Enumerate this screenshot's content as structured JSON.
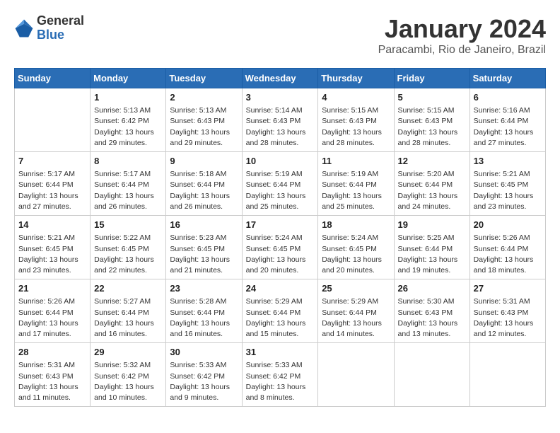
{
  "header": {
    "logo_general": "General",
    "logo_blue": "Blue",
    "title": "January 2024",
    "subtitle": "Paracambi, Rio de Janeiro, Brazil"
  },
  "calendar": {
    "days_of_week": [
      "Sunday",
      "Monday",
      "Tuesday",
      "Wednesday",
      "Thursday",
      "Friday",
      "Saturday"
    ],
    "weeks": [
      [
        {
          "day": "",
          "info": ""
        },
        {
          "day": "1",
          "info": "Sunrise: 5:13 AM\nSunset: 6:42 PM\nDaylight: 13 hours\nand 29 minutes."
        },
        {
          "day": "2",
          "info": "Sunrise: 5:13 AM\nSunset: 6:43 PM\nDaylight: 13 hours\nand 29 minutes."
        },
        {
          "day": "3",
          "info": "Sunrise: 5:14 AM\nSunset: 6:43 PM\nDaylight: 13 hours\nand 28 minutes."
        },
        {
          "day": "4",
          "info": "Sunrise: 5:15 AM\nSunset: 6:43 PM\nDaylight: 13 hours\nand 28 minutes."
        },
        {
          "day": "5",
          "info": "Sunrise: 5:15 AM\nSunset: 6:43 PM\nDaylight: 13 hours\nand 28 minutes."
        },
        {
          "day": "6",
          "info": "Sunrise: 5:16 AM\nSunset: 6:44 PM\nDaylight: 13 hours\nand 27 minutes."
        }
      ],
      [
        {
          "day": "7",
          "info": "Sunrise: 5:17 AM\nSunset: 6:44 PM\nDaylight: 13 hours\nand 27 minutes."
        },
        {
          "day": "8",
          "info": "Sunrise: 5:17 AM\nSunset: 6:44 PM\nDaylight: 13 hours\nand 26 minutes."
        },
        {
          "day": "9",
          "info": "Sunrise: 5:18 AM\nSunset: 6:44 PM\nDaylight: 13 hours\nand 26 minutes."
        },
        {
          "day": "10",
          "info": "Sunrise: 5:19 AM\nSunset: 6:44 PM\nDaylight: 13 hours\nand 25 minutes."
        },
        {
          "day": "11",
          "info": "Sunrise: 5:19 AM\nSunset: 6:44 PM\nDaylight: 13 hours\nand 25 minutes."
        },
        {
          "day": "12",
          "info": "Sunrise: 5:20 AM\nSunset: 6:44 PM\nDaylight: 13 hours\nand 24 minutes."
        },
        {
          "day": "13",
          "info": "Sunrise: 5:21 AM\nSunset: 6:45 PM\nDaylight: 13 hours\nand 23 minutes."
        }
      ],
      [
        {
          "day": "14",
          "info": "Sunrise: 5:21 AM\nSunset: 6:45 PM\nDaylight: 13 hours\nand 23 minutes."
        },
        {
          "day": "15",
          "info": "Sunrise: 5:22 AM\nSunset: 6:45 PM\nDaylight: 13 hours\nand 22 minutes."
        },
        {
          "day": "16",
          "info": "Sunrise: 5:23 AM\nSunset: 6:45 PM\nDaylight: 13 hours\nand 21 minutes."
        },
        {
          "day": "17",
          "info": "Sunrise: 5:24 AM\nSunset: 6:45 PM\nDaylight: 13 hours\nand 20 minutes."
        },
        {
          "day": "18",
          "info": "Sunrise: 5:24 AM\nSunset: 6:45 PM\nDaylight: 13 hours\nand 20 minutes."
        },
        {
          "day": "19",
          "info": "Sunrise: 5:25 AM\nSunset: 6:44 PM\nDaylight: 13 hours\nand 19 minutes."
        },
        {
          "day": "20",
          "info": "Sunrise: 5:26 AM\nSunset: 6:44 PM\nDaylight: 13 hours\nand 18 minutes."
        }
      ],
      [
        {
          "day": "21",
          "info": "Sunrise: 5:26 AM\nSunset: 6:44 PM\nDaylight: 13 hours\nand 17 minutes."
        },
        {
          "day": "22",
          "info": "Sunrise: 5:27 AM\nSunset: 6:44 PM\nDaylight: 13 hours\nand 16 minutes."
        },
        {
          "day": "23",
          "info": "Sunrise: 5:28 AM\nSunset: 6:44 PM\nDaylight: 13 hours\nand 16 minutes."
        },
        {
          "day": "24",
          "info": "Sunrise: 5:29 AM\nSunset: 6:44 PM\nDaylight: 13 hours\nand 15 minutes."
        },
        {
          "day": "25",
          "info": "Sunrise: 5:29 AM\nSunset: 6:44 PM\nDaylight: 13 hours\nand 14 minutes."
        },
        {
          "day": "26",
          "info": "Sunrise: 5:30 AM\nSunset: 6:43 PM\nDaylight: 13 hours\nand 13 minutes."
        },
        {
          "day": "27",
          "info": "Sunrise: 5:31 AM\nSunset: 6:43 PM\nDaylight: 13 hours\nand 12 minutes."
        }
      ],
      [
        {
          "day": "28",
          "info": "Sunrise: 5:31 AM\nSunset: 6:43 PM\nDaylight: 13 hours\nand 11 minutes."
        },
        {
          "day": "29",
          "info": "Sunrise: 5:32 AM\nSunset: 6:42 PM\nDaylight: 13 hours\nand 10 minutes."
        },
        {
          "day": "30",
          "info": "Sunrise: 5:33 AM\nSunset: 6:42 PM\nDaylight: 13 hours\nand 9 minutes."
        },
        {
          "day": "31",
          "info": "Sunrise: 5:33 AM\nSunset: 6:42 PM\nDaylight: 13 hours\nand 8 minutes."
        },
        {
          "day": "",
          "info": ""
        },
        {
          "day": "",
          "info": ""
        },
        {
          "day": "",
          "info": ""
        }
      ]
    ]
  }
}
